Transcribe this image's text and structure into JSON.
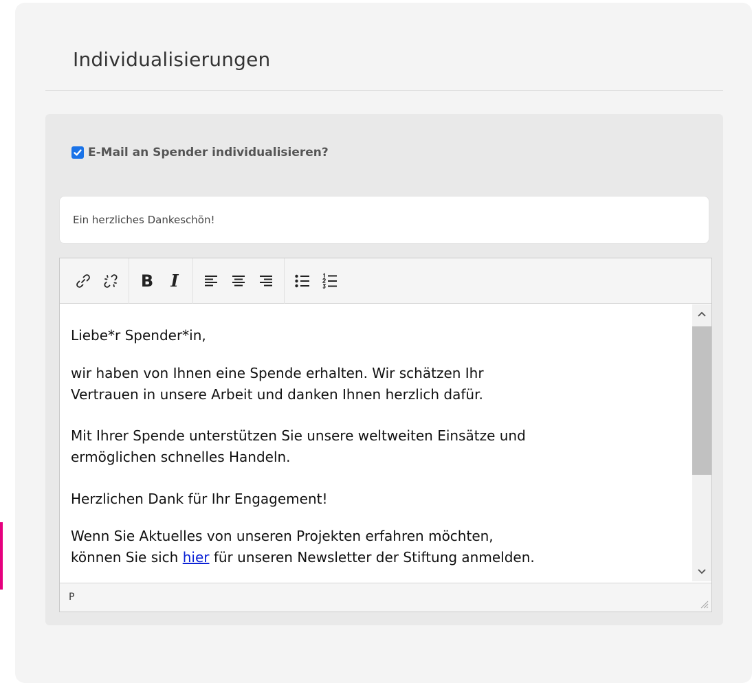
{
  "card": {
    "title": "Individualisierungen"
  },
  "customize_option": {
    "label": "E-Mail an Spender individualisieren?",
    "checked": true
  },
  "subject": {
    "value": "Ein herzliches Dankeschön!"
  },
  "toolbar": {
    "groups": [
      [
        "link-icon",
        "unlink-icon"
      ],
      [
        "bold",
        "italic"
      ],
      [
        "align-left-icon",
        "align-center-icon",
        "align-right-icon"
      ],
      [
        "bullet-list-icon",
        "numbered-list-icon"
      ]
    ],
    "bold_label": "B",
    "italic_label": "I"
  },
  "editor": {
    "greeting": "Liebe*r Spender*in,",
    "p1_line1": "wir haben von Ihnen eine Spende erhalten. Wir schätzen Ihr",
    "p1_line2": "Vertrauen in unsere Arbeit und danken Ihnen herzlich dafür.",
    "p2_line1": "Mit Ihrer Spende unterstützen Sie unsere weltweiten Einsätze und",
    "p2_line2": "ermöglichen schnelles Handeln.",
    "p3": "Herzlichen Dank für Ihr Engagement!",
    "p4_line1": "Wenn Sie Aktuelles von unseren Projekten erfahren möchten,",
    "p4_pre": "können Sie sich ",
    "p4_link": "hier",
    "p4_post": " für unseren Newsletter der Stiftung anmelden.",
    "scroll_fraction_visible": 0.55
  },
  "statusbar": {
    "path": "P"
  },
  "colors": {
    "accent_pink": "#e6007e",
    "checkbox_blue": "#1a73e8",
    "link_blue": "#0b22d6"
  }
}
